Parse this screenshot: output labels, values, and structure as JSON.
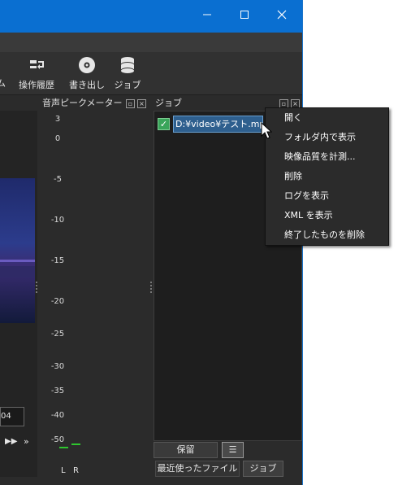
{
  "toolbar": {
    "partial_label": "ム",
    "history_label": "操作履歴",
    "export_label": "書き出し",
    "jobs_label": "ジョブ"
  },
  "panels": {
    "meter_title": "音声ピークメーター",
    "jobs_title": "ジョブ"
  },
  "meter": {
    "scale": [
      "3",
      "0",
      "-5",
      "-10",
      "-15",
      "-20",
      "-25",
      "-30",
      "-35",
      "-40",
      "-50"
    ],
    "channels": [
      "L",
      "R"
    ]
  },
  "player": {
    "timecode_fragment": "04",
    "ff_symbol": "▶▶",
    "next_symbol": "»"
  },
  "jobs": {
    "items": [
      {
        "name": "D:¥video¥テスト.mp4",
        "checked": true
      }
    ],
    "hold_button": "保留",
    "menu_button": "☰"
  },
  "tabs": {
    "recent": "最近使ったファイル",
    "jobs": "ジョブ"
  },
  "context_menu": {
    "items": [
      "開く",
      "フォルダ内で表示",
      "映像品質を計測...",
      "削除",
      "ログを表示",
      "XML を表示",
      "終了したものを削除"
    ]
  },
  "colors": {
    "titlebar": "#0a6fd1",
    "background": "#2b2b2b",
    "job_highlight": "#2e5f8e",
    "meter_green": "#2ec62e"
  }
}
